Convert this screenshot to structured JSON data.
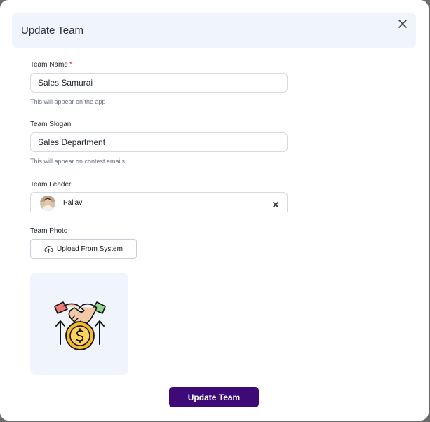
{
  "modal": {
    "title": "Update Team",
    "close_icon": "close-icon"
  },
  "form": {
    "team_name": {
      "label": "Team Name",
      "required_marker": "*",
      "value": "Sales Samurai",
      "hint": "This will appear on the app"
    },
    "team_slogan": {
      "label": "Team Slogan",
      "value": "Sales Department",
      "hint": "This will appear on contest emails"
    },
    "team_leader": {
      "label": "Team Leader",
      "selected": "Pallav",
      "avatar_icon": "avatar",
      "clear_icon": "clear-icon"
    },
    "team_photo": {
      "label": "Team Photo",
      "upload_label": "Upload From System",
      "upload_icon": "cloud-upload-icon",
      "preview_icon": "handshake-dollar-icon"
    }
  },
  "actions": {
    "submit_label": "Update Team"
  },
  "colors": {
    "header_bg": "#f0f5fd",
    "primary": "#3d0a78",
    "required": "#e0242b",
    "backdrop": "#6b6b6b"
  }
}
